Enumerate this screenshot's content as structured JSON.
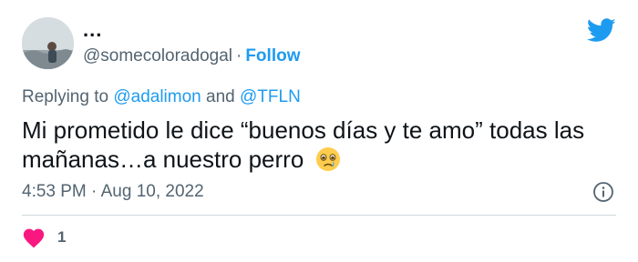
{
  "author": {
    "display_name": "...",
    "handle": "@somecoloradogal",
    "separator": "·",
    "follow_label": "Follow"
  },
  "reply": {
    "prefix": "Replying to",
    "mention_1": "@adalimon",
    "conjunction": "and",
    "mention_2": "@TFLN"
  },
  "tweet": {
    "text": "Mi prometido le dice “buenos días y te amo” todas las mañanas…a nuestro perro",
    "emoji_icon": "face-holding-back-tears-icon"
  },
  "meta": {
    "time": "4:53 PM",
    "separator": "·",
    "date": "Aug 10, 2022"
  },
  "engagement": {
    "likes": "1"
  },
  "colors": {
    "accent": "#1d9bf0",
    "heart": "#f91880",
    "secondary_text": "#536471"
  }
}
